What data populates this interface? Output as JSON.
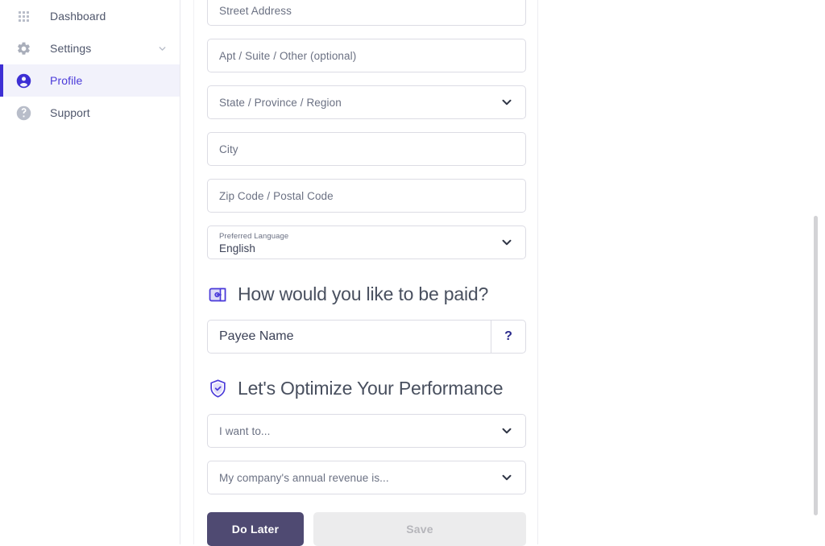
{
  "sidebar": {
    "items": [
      {
        "id": "dashboard",
        "label": "Dashboard",
        "icon": "grid-icon",
        "active": false,
        "chevron": false
      },
      {
        "id": "settings",
        "label": "Settings",
        "icon": "gear-icon",
        "active": false,
        "chevron": true
      },
      {
        "id": "profile",
        "label": "Profile",
        "icon": "user-circle-icon",
        "active": true,
        "chevron": false
      },
      {
        "id": "support",
        "label": "Support",
        "icon": "question-circle-icon",
        "active": false,
        "chevron": false
      }
    ]
  },
  "form": {
    "address_fields": [
      {
        "id": "street-address",
        "placeholder": "Street Address",
        "type": "text"
      },
      {
        "id": "apt-suite",
        "placeholder": "Apt / Suite / Other (optional)",
        "type": "text"
      },
      {
        "id": "state-province",
        "placeholder": "State / Province / Region",
        "type": "select"
      },
      {
        "id": "city",
        "placeholder": "City",
        "type": "text"
      },
      {
        "id": "zip-code",
        "placeholder": "Zip Code / Postal Code",
        "type": "text"
      }
    ],
    "preferred_language": {
      "label": "Preferred Language",
      "value": "English"
    }
  },
  "payment_section": {
    "icon": "wallet-icon",
    "title": "How would you like to be paid?",
    "payee": {
      "placeholder": "Payee Name",
      "value": "",
      "help_label": "?"
    }
  },
  "performance_section": {
    "icon": "shield-check-icon",
    "title": "Let's Optimize Your Performance",
    "selects": [
      {
        "id": "intent",
        "placeholder": "I want to..."
      },
      {
        "id": "revenue",
        "placeholder": "My company's annual revenue is..."
      }
    ]
  },
  "actions": {
    "do_later_label": "Do Later",
    "save_label": "Save"
  },
  "colors": {
    "accent": "#3d2fd4",
    "accent_text": "#4a3ad9",
    "active_bg": "#f2f2fb",
    "secondary_button": "#4f4a72",
    "disabled_button_bg": "#ececed",
    "disabled_button_text": "#b6b6bb",
    "border": "#dcdce4",
    "text": "#3c4257",
    "muted_text": "#6b7183",
    "icon_muted": "#b8bdc9"
  }
}
